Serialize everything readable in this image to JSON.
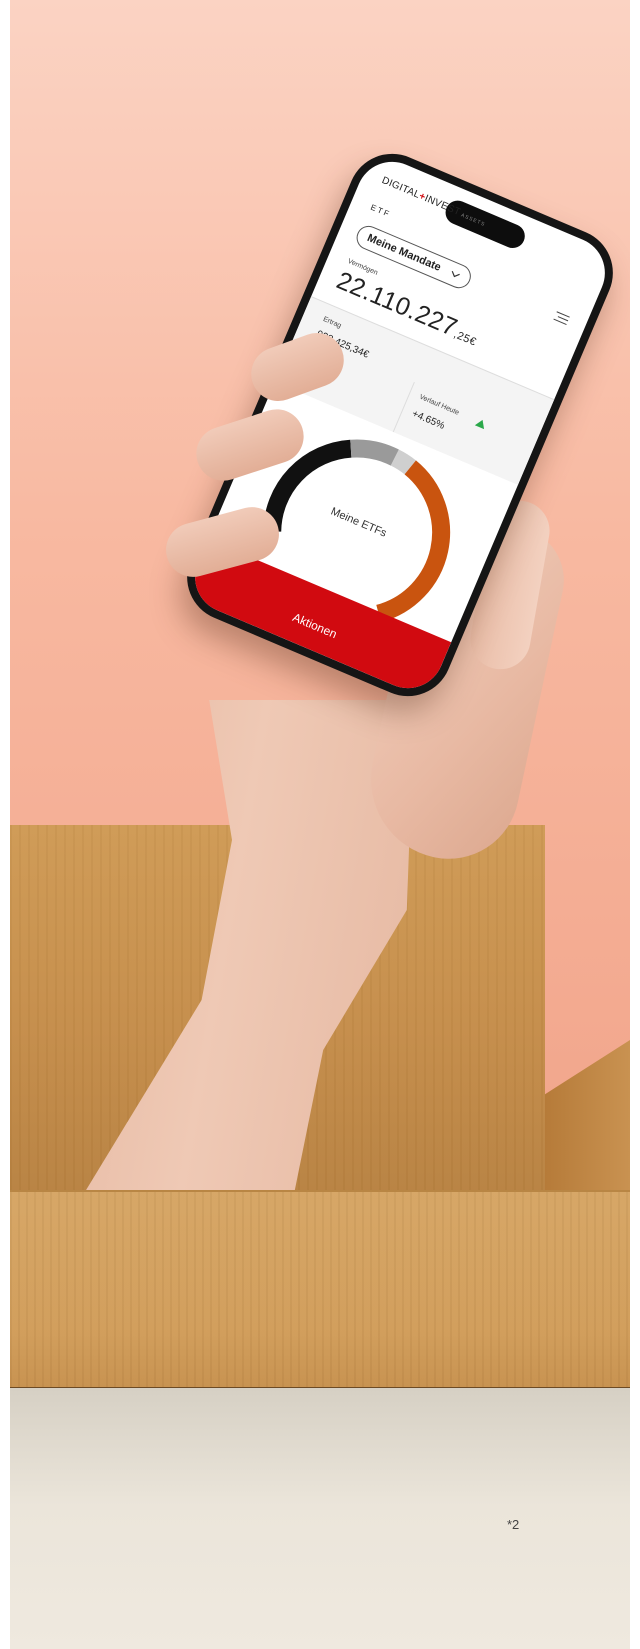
{
  "phone_app": {
    "logo": {
      "left": "DIGITAL",
      "plus": "+",
      "right": "INVEST",
      "sub": "ASSETS"
    },
    "section_label": "ETF",
    "mandate_select": {
      "value": "Meine Mandate"
    },
    "assets": {
      "label": "Vermögen",
      "value_main": "22.110.227",
      "value_cents": ",25€"
    },
    "return": {
      "label": "Ertrag",
      "value": "923.425,34€"
    },
    "today": {
      "label": "Verlauf Heute",
      "value": "+4.65%"
    },
    "chart_title": "Meine ETFs",
    "action_button": {
      "label": "Aktionen"
    }
  },
  "footnote": "*2",
  "colors": {
    "accent": "#d10a10",
    "positive": "#2ba84a",
    "donut_orange": "#c9540f",
    "donut_black": "#111111",
    "donut_gray": "#9a9a9a",
    "donut_light_gray": "#cfcfcf"
  }
}
